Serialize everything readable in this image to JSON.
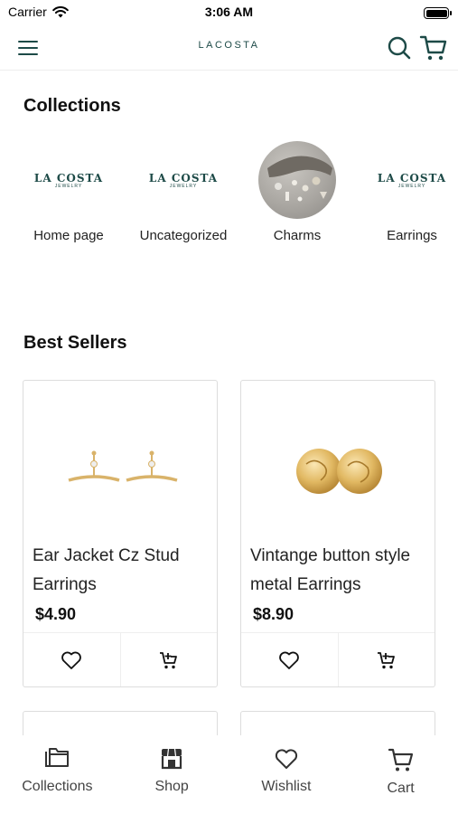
{
  "status_bar": {
    "carrier": "Carrier",
    "time": "3:06 AM"
  },
  "header": {
    "brand": "LACOSTA"
  },
  "collections": {
    "title": "Collections",
    "items": [
      {
        "label": "Home page",
        "thumb": "logo",
        "logo_text": "LA COSTA",
        "logo_sub": "JEWELRY"
      },
      {
        "label": "Uncategorized",
        "thumb": "logo",
        "logo_text": "LA COSTA",
        "logo_sub": "JEWELRY"
      },
      {
        "label": "Charms",
        "thumb": "photo"
      },
      {
        "label": "Earrings",
        "thumb": "logo",
        "logo_text": "LA COSTA",
        "logo_sub": "JEWELRY"
      }
    ]
  },
  "best_sellers": {
    "title": "Best Sellers",
    "products": [
      {
        "name": "Ear Jacket Cz Stud Earrings",
        "price": "$4.90",
        "image": "ear-jacket-earrings"
      },
      {
        "name": "Vintange button style metal Earrings",
        "price": "$8.90",
        "image": "button-earrings"
      }
    ]
  },
  "tab_bar": {
    "tabs": [
      {
        "label": "Collections",
        "icon": "collections-icon"
      },
      {
        "label": "Shop",
        "icon": "shop-icon"
      },
      {
        "label": "Wishlist",
        "icon": "heart-icon"
      },
      {
        "label": "Cart",
        "icon": "cart-icon"
      }
    ]
  },
  "colors": {
    "brand": "#1d4a47",
    "text": "#111111",
    "border": "#dddddd",
    "gold": "#d9b36a"
  }
}
